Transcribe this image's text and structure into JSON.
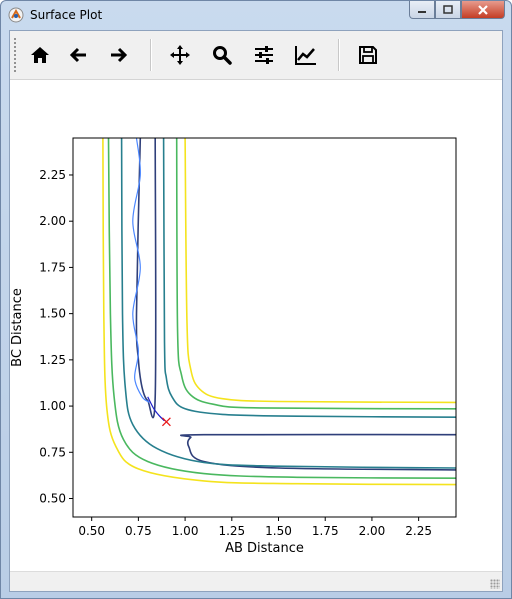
{
  "window": {
    "title": "Surface Plot"
  },
  "toolbar": {
    "buttons": [
      {
        "name": "home-button",
        "icon": "home-icon"
      },
      {
        "name": "back-button",
        "icon": "arrow-left-icon"
      },
      {
        "name": "forward-button",
        "icon": "arrow-right-icon"
      },
      {
        "name": "pan-button",
        "icon": "move-icon"
      },
      {
        "name": "zoom-button",
        "icon": "magnifier-icon"
      },
      {
        "name": "configure-subplots-button",
        "icon": "sliders-icon"
      },
      {
        "name": "edit-axis-button",
        "icon": "line-chart-icon"
      },
      {
        "name": "save-button",
        "icon": "floppy-disk-icon"
      }
    ]
  },
  "chart_data": {
    "type": "contour",
    "title": "",
    "xlabel": "AB Distance",
    "ylabel": "BC Distance",
    "xlim": [
      0.4,
      2.45
    ],
    "ylim": [
      0.4,
      2.45
    ],
    "xticks": [
      "0.50",
      "0.75",
      "1.00",
      "1.25",
      "1.50",
      "1.75",
      "2.00",
      "2.25"
    ],
    "xtick_values": [
      0.5,
      0.75,
      1.0,
      1.25,
      1.5,
      1.75,
      2.0,
      2.25
    ],
    "yticks": [
      "0.50",
      "0.75",
      "1.00",
      "1.25",
      "1.50",
      "1.75",
      "2.00",
      "2.25"
    ],
    "ytick_values": [
      0.5,
      0.75,
      1.0,
      1.25,
      1.5,
      1.75,
      2.0,
      2.25
    ],
    "grid": false,
    "contours": [
      {
        "level_rank": 0,
        "color": "#2f3f7a",
        "closed_loops": [
          [
            [
              0.76,
              2.45
            ],
            [
              0.74,
              1.5
            ],
            [
              0.75,
              1.25
            ],
            [
              0.77,
              1.1
            ],
            [
              0.8,
              1.03
            ],
            [
              0.84,
              1.05
            ],
            [
              0.84,
              2.45
            ]
          ],
          [
            [
              2.45,
              0.845
            ],
            [
              1.1,
              0.845
            ],
            [
              1.03,
              0.83
            ],
            [
              1.02,
              0.78
            ],
            [
              1.1,
              0.7
            ],
            [
              1.5,
              0.665
            ],
            [
              2.45,
              0.655
            ]
          ]
        ]
      },
      {
        "level_rank": 1,
        "color": "#277f8e",
        "curves": [
          [
            [
              0.66,
              2.45
            ],
            [
              0.665,
              1.5
            ],
            [
              0.68,
              1.1
            ],
            [
              0.72,
              0.9
            ],
            [
              0.85,
              0.77
            ],
            [
              1.1,
              0.695
            ],
            [
              1.5,
              0.675
            ],
            [
              2.45,
              0.665
            ]
          ],
          [
            [
              0.885,
              2.45
            ],
            [
              0.89,
              1.35
            ],
            [
              0.9,
              1.15
            ],
            [
              0.93,
              1.05
            ],
            [
              1.0,
              0.985
            ],
            [
              1.2,
              0.955
            ],
            [
              1.6,
              0.945
            ],
            [
              2.45,
              0.94
            ]
          ]
        ]
      },
      {
        "level_rank": 2,
        "color": "#4ab85f",
        "curves": [
          [
            [
              0.59,
              2.45
            ],
            [
              0.6,
              1.5
            ],
            [
              0.62,
              1.05
            ],
            [
              0.67,
              0.82
            ],
            [
              0.8,
              0.7
            ],
            [
              1.1,
              0.635
            ],
            [
              1.6,
              0.615
            ],
            [
              2.45,
              0.61
            ]
          ],
          [
            [
              0.955,
              2.45
            ],
            [
              0.96,
              1.4
            ],
            [
              0.98,
              1.17
            ],
            [
              1.03,
              1.06
            ],
            [
              1.15,
              1.01
            ],
            [
              1.4,
              0.99
            ],
            [
              2.45,
              0.985
            ]
          ]
        ]
      },
      {
        "level_rank": 3,
        "color": "#f4e31d",
        "curves": [
          [
            [
              0.56,
              2.45
            ],
            [
              0.565,
              1.5
            ],
            [
              0.58,
              1.0
            ],
            [
              0.63,
              0.78
            ],
            [
              0.75,
              0.66
            ],
            [
              1.1,
              0.595
            ],
            [
              1.6,
              0.58
            ],
            [
              2.45,
              0.575
            ]
          ],
          [
            [
              1.0,
              2.45
            ],
            [
              1.01,
              1.45
            ],
            [
              1.03,
              1.2
            ],
            [
              1.08,
              1.09
            ],
            [
              1.2,
              1.04
            ],
            [
              1.5,
              1.025
            ],
            [
              2.45,
              1.02
            ]
          ]
        ]
      }
    ],
    "trajectories": [
      {
        "color": "#4a86ff",
        "points": [
          [
            0.74,
            2.45
          ],
          [
            0.76,
            2.25
          ],
          [
            0.72,
            2.0
          ],
          [
            0.76,
            1.75
          ],
          [
            0.72,
            1.5
          ],
          [
            0.75,
            1.3
          ],
          [
            0.73,
            1.15
          ],
          [
            0.77,
            1.05
          ],
          [
            0.81,
            1.02
          ]
        ]
      },
      {
        "color": "#1f1fcc",
        "points": [
          [
            0.8,
            1.05
          ],
          [
            0.83,
            0.99
          ],
          [
            0.86,
            0.95
          ],
          [
            0.89,
            0.92
          ]
        ]
      }
    ],
    "markers": [
      {
        "x": 0.9,
        "y": 0.915,
        "symbol": "x",
        "color": "#e8191b"
      }
    ]
  }
}
